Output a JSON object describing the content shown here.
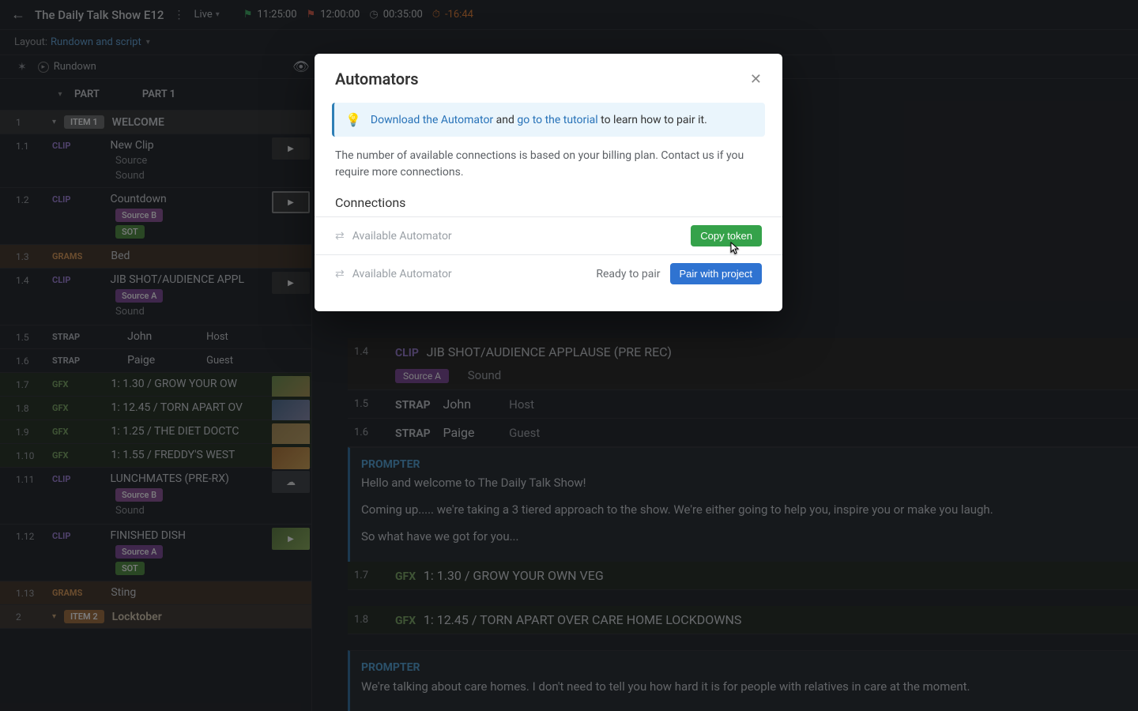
{
  "topbar": {
    "title": "The Daily Talk Show E12",
    "live": "Live",
    "time_green": "11:25:00",
    "time_red": "12:00:00",
    "duration": "00:35:00",
    "countdown": "-16:44"
  },
  "layoutbar": {
    "label": "Layout:",
    "value": "Rundown and script"
  },
  "secbar": {
    "rundown": "Rundown"
  },
  "part_header": {
    "part_label": "PART",
    "part_title": "PART 1"
  },
  "items": {
    "i1": {
      "n": "1",
      "tag": "ITEM 1",
      "title": "WELCOME"
    },
    "i11": {
      "n": "1.1",
      "tag": "CLIP",
      "title": "New Clip",
      "sub1": "Source",
      "sub2": "Sound"
    },
    "i12": {
      "n": "1.2",
      "tag": "CLIP",
      "title": "Countdown",
      "pill1": "Source B",
      "pill2": "SOT"
    },
    "i13": {
      "n": "1.3",
      "tag": "GRAMS",
      "title": "Bed"
    },
    "i14": {
      "n": "1.4",
      "tag": "CLIP",
      "title": "JIB SHOT/AUDIENCE APPL",
      "pill1": "Source A",
      "sub2": "Sound"
    },
    "i15": {
      "n": "1.5",
      "tag": "STRAP",
      "c1": "John",
      "c2": "Host"
    },
    "i16": {
      "n": "1.6",
      "tag": "STRAP",
      "c1": "Paige",
      "c2": "Guest"
    },
    "i17": {
      "n": "1.7",
      "tag": "GFX",
      "title": "1: 1.30 / GROW YOUR OW"
    },
    "i18": {
      "n": "1.8",
      "tag": "GFX",
      "title": "1: 12.45 / TORN APART OV"
    },
    "i19": {
      "n": "1.9",
      "tag": "GFX",
      "title": "1: 1.25 / THE DIET DOCTC"
    },
    "i110": {
      "n": "1.10",
      "tag": "GFX",
      "title": "1: 1.55 / FREDDY'S WEST "
    },
    "i111": {
      "n": "1.11",
      "tag": "CLIP",
      "title": "LUNCHMATES (PRE-RX)",
      "pill1": "Source B",
      "sub2": "Sound"
    },
    "i112": {
      "n": "1.12",
      "tag": "CLIP",
      "title": "FINISHED DISH",
      "pill1": "Source A",
      "pill2": "SOT"
    },
    "i113": {
      "n": "1.13",
      "tag": "GRAMS",
      "title": "Sting"
    },
    "i2": {
      "n": "2",
      "tag": "ITEM 2",
      "title": "Locktober"
    }
  },
  "script": {
    "r14": {
      "n": "1.4",
      "tag": "CLIP",
      "title": "JIB SHOT/AUDIENCE APPLAUSE (PRE REC)",
      "pill": "Source A",
      "sub": "Sound"
    },
    "r15": {
      "n": "1.5",
      "tag": "STRAP",
      "c1": "John",
      "c2": "Host"
    },
    "r16": {
      "n": "1.6",
      "tag": "STRAP",
      "c1": "Paige",
      "c2": "Guest"
    },
    "prompter1": {
      "tag": "PROMPTER",
      "p1": "Hello and welcome to The Daily Talk Show!",
      "p2": "Coming up..... we're taking a 3 tiered approach to the show. We're either going to help you, inspire you or make you laugh.",
      "p3": "So what have we got for you..."
    },
    "r17": {
      "n": "1.7",
      "tag": "GFX",
      "title": "1: 1.30 / GROW YOUR OWN VEG"
    },
    "r18": {
      "n": "1.8",
      "tag": "GFX",
      "title": "1: 12.45 / TORN APART OVER CARE HOME LOCKDOWNS"
    },
    "prompter2": {
      "tag": "PROMPTER",
      "p1": "We're talking about care homes. I don't need to tell you how hard it is for people with relatives in care at the moment."
    }
  },
  "modal": {
    "title": "Automators",
    "link1": "Download the Automator",
    "mid": " and ",
    "link2": "go to the tutorial",
    "tail": " to learn how to pair it.",
    "desc": "The number of available connections is based on your billing plan. Contact us if you require more connections.",
    "connections": "Connections",
    "avail": "Available Automator",
    "copy": "Copy token",
    "ready": "Ready to pair",
    "pair": "Pair with project"
  }
}
